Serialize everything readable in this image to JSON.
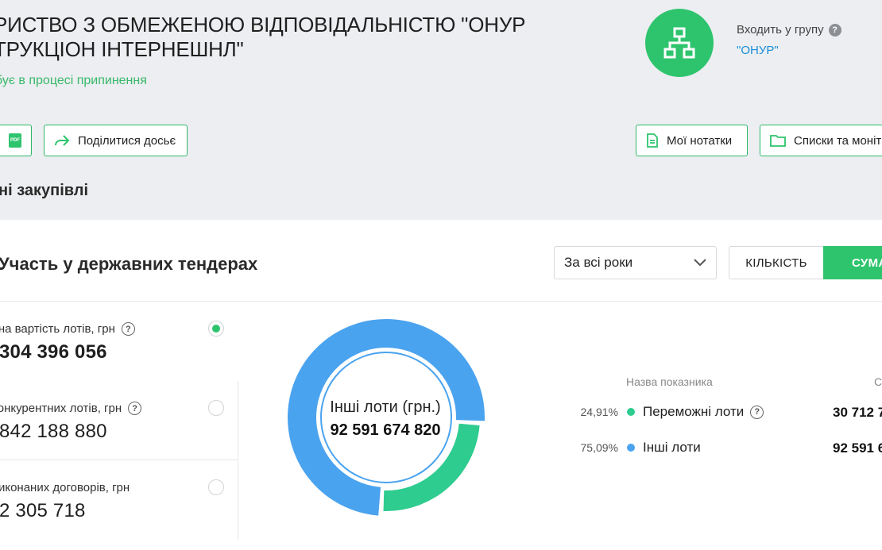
{
  "company": {
    "title": "РИСТВО З ОБМЕЖЕНОЮ ВІДПОВІДАЛЬНІСТЮ \"ОНУР ТРУКЦІОН ІНТЕРНЕШНЛ\"",
    "status": "бує в процесі припинення",
    "group_label": "Входить у групу",
    "group_name": "\"ОНУР\""
  },
  "toolbar": {
    "pdf_badge": "PDF",
    "share_label": "Поділитися досьє",
    "notes_label": "Мої нотатки",
    "lists_label": "Списки та моніт"
  },
  "section_heading": "ні закупівлі",
  "panel": {
    "title": "Участь у державних тендерах",
    "period_select": "За всі роки",
    "toggle_qty": "КІЛЬКІСТЬ",
    "toggle_sum": "СУМА"
  },
  "stats": [
    {
      "label": "ьна вартість лотів, грн",
      "value": "304 396 056",
      "selected": true
    },
    {
      "label": "конкурентних лотів, грн",
      "value": "842 188 880",
      "selected": false
    },
    {
      "label": "виконаних договорів, грн",
      "value": "2 305 718",
      "selected": false
    }
  ],
  "chart_data": {
    "type": "pie",
    "center_label": "Інші лоти (грн.)",
    "center_value": "92 591 674 820",
    "legend_header_name": "Назва показника",
    "legend_header_sum": "С",
    "slices": [
      {
        "name": "Переможні лоти",
        "percent_label": "24,91%",
        "percent": 24.91,
        "sum_label": "30 712 7",
        "color": "#2ecc8f"
      },
      {
        "name": "Інші лоти",
        "percent_label": "75,09%",
        "percent": 75.09,
        "sum_label": "92 591 6",
        "color": "#4aa3ef"
      }
    ]
  },
  "colors": {
    "accent": "#2ec46d",
    "link": "#1a8fd8"
  }
}
